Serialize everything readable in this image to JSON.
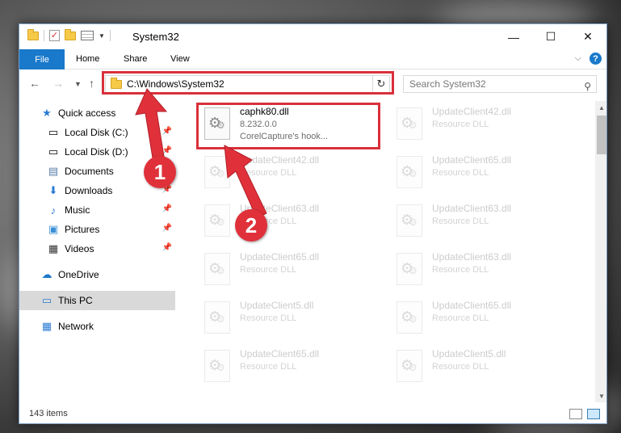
{
  "window": {
    "title": "System32"
  },
  "ribbon": {
    "file": "File",
    "home": "Home",
    "share": "Share",
    "view": "View"
  },
  "address": {
    "path": "C:\\Windows\\System32",
    "search_placeholder": "Search System32"
  },
  "nav": {
    "quick_access": "Quick access",
    "local_c": "Local Disk (C:)",
    "local_d": "Local Disk (D:)",
    "documents": "Documents",
    "downloads": "Downloads",
    "music": "Music",
    "pictures": "Pictures",
    "videos": "Videos",
    "onedrive": "OneDrive",
    "this_pc": "This PC",
    "network": "Network"
  },
  "files": {
    "highlighted": {
      "name": "caphk80.dll",
      "version": "8.232.0.0",
      "description": "CorelCapture's hook..."
    },
    "col1": [
      {
        "name": "UpdateClient42.dll",
        "type": "Resource DLL"
      },
      {
        "name": "UpdateClient63.dll",
        "type": "Resource DLL"
      },
      {
        "name": "UpdateClient65.dll",
        "type": "Resource DLL"
      },
      {
        "name": "UpdateClient5.dll",
        "type": "Resource DLL"
      },
      {
        "name": "UpdateClient65.dll",
        "type": "Resource DLL"
      }
    ],
    "col2": [
      {
        "name": "UpdateClient42.dll",
        "type": "Resource DLL"
      },
      {
        "name": "UpdateClient65.dll",
        "type": "Resource DLL"
      },
      {
        "name": "UpdateClient63.dll",
        "type": "Resource DLL"
      },
      {
        "name": "UpdateClient63.dll",
        "type": "Resource DLL"
      },
      {
        "name": "UpdateClient65.dll",
        "type": "Resource DLL"
      },
      {
        "name": "UpdateClient5.dll",
        "type": "Resource DLL"
      }
    ]
  },
  "status": {
    "item_count": "143 items"
  },
  "annotations": {
    "step1": "1",
    "step2": "2"
  },
  "colors": {
    "accent": "#1979ca",
    "highlight": "#d9303a",
    "selected_nav": "#d9d9d9"
  }
}
